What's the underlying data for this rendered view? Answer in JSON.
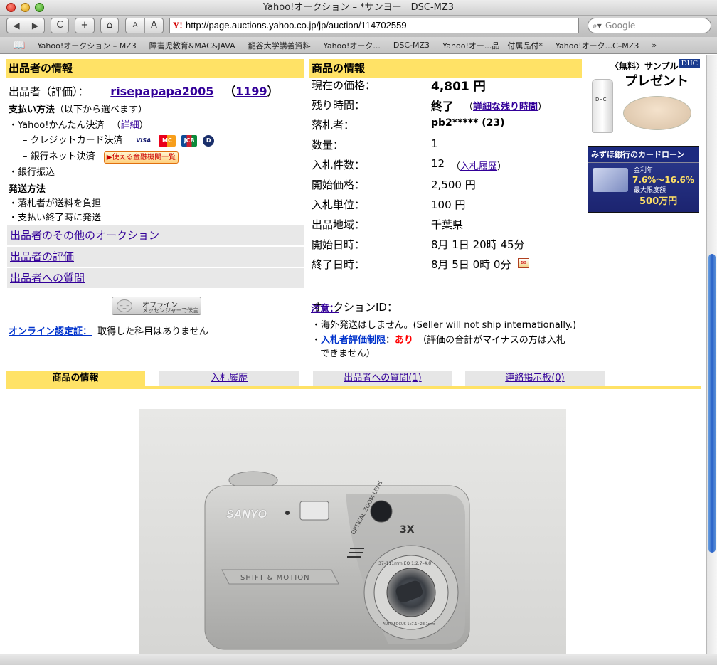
{
  "window": {
    "title": "Yahoo!オークション – *サンヨー　DSC-MZ3"
  },
  "toolbar": {
    "back": "◀",
    "forward": "▶",
    "reload": "C",
    "add": "+",
    "home": "⌂",
    "font_small": "A",
    "font_large": "A",
    "url_icon": "Y!",
    "url": "http://page.auctions.yahoo.co.jp/jp/auction/114702559",
    "search_placeholder": "Google"
  },
  "bookmarks": [
    "Yahoo!オークション – MZ3",
    "障害児教育&MAC&JAVA",
    "龍谷大学講義資料",
    "Yahoo!オーク...",
    "DSC-MZ3",
    "Yahoo!オー...品　付属品付*",
    "Yahoo!オーク...C–MZ3",
    "»"
  ],
  "seller": {
    "section_title": "出品者の情報",
    "label": "出品者（評価）：",
    "name": "risepapapa2005",
    "rating_open": "（",
    "rating": "1199",
    "rating_close": "）",
    "payment_title": "支払い方法",
    "payment_note": "（以下から選べます）",
    "easy_pay": "・Yahoo!かんたん決済",
    "detail_open": "（",
    "detail_link": "詳細",
    "detail_close": "）",
    "credit": "– クレジットカード決済",
    "cards": [
      "VISA",
      "MC",
      "JCB",
      "D"
    ],
    "bank_net": "– 銀行ネット決済",
    "bank_button": "▶使える金融機関一覧",
    "bank_transfer": "・銀行振込",
    "shipping_title": "発送方法",
    "ship1": "・落札者が送料を負担",
    "ship2": "・支払い終了時に発送",
    "links": [
      "出品者のその他のオークション",
      "出品者の評価",
      "出品者への質問"
    ],
    "messenger_status": "オフライン",
    "messenger_sub": "メッセンジャーで伝言",
    "online_cert_label": "オンライン認定証：",
    "online_cert_value": "取得した科目はありません"
  },
  "item": {
    "section_title": "商品の情報",
    "rows": [
      {
        "label": "現在の価格：",
        "value": "4,801 円"
      },
      {
        "label": "残り時間：",
        "value": "終了"
      },
      {
        "label": "落札者：",
        "value": "pb2***** (23)"
      },
      {
        "label": "数量：",
        "value": "1"
      },
      {
        "label": "入札件数：",
        "value": "12"
      },
      {
        "label": "開始価格：",
        "value": "2,500 円"
      },
      {
        "label": "入札単位：",
        "value": "100 円"
      },
      {
        "label": "出品地域：",
        "value": "千葉県"
      },
      {
        "label": "開始日時：",
        "value": "8月 1日 20時 45分"
      },
      {
        "label": "終了日時：",
        "value": "8月 5日 0時 0分"
      },
      {
        "label": "オークションID：",
        "value": ""
      }
    ],
    "remaining_link_open": "（",
    "remaining_link": "詳細な残り時間",
    "remaining_link_close": "）",
    "bid_history_open": "（",
    "bid_history_link": "入札履歴",
    "bid_history_close": "）",
    "notes_title": "注意：",
    "note1": "・海外発送はしません。(Seller will not ship internationally.)",
    "note2_bullet": "・",
    "note2_link": "入札者評価制限",
    "note2_sep": "：",
    "note2_flag": "あり",
    "note2_text1": "（評価の合計がマイナスの方は入札",
    "note2_text2": "できません）"
  },
  "ads": {
    "dhc_badge": "DHC",
    "dhc_line1": "〈無料〉サンプル",
    "dhc_line2": "プレゼント",
    "dhc_product": "DHC",
    "bank_title": "みずほ銀行のカードローン",
    "bank_rate_label": "金利年",
    "bank_rate": "7.6%〜16.6%",
    "bank_limit_label": "最大限度額",
    "bank_limit": "500万円"
  },
  "tabs": [
    {
      "label": "商品の情報",
      "active": true
    },
    {
      "label": "入札履歴",
      "active": false
    },
    {
      "label": "出品者への質問(1)",
      "active": false
    },
    {
      "label": "連絡掲示板(0)",
      "active": false
    }
  ],
  "photo": {
    "brand": "SANYO",
    "lens_text": "OPTICAL ZOOM LENS",
    "zoom": "3X",
    "front_text": "SHIFT & MOTION",
    "lens_ring": "37–111mm EQ 1:2.7–4.8",
    "af_text": "AUTO FOCUS 1x7.1~23.1mm"
  },
  "colors": {
    "section_yellow": "#ffe266",
    "link": "#330099",
    "gray_bar": "#e8e8e8",
    "alert_red": "#ff0000"
  }
}
